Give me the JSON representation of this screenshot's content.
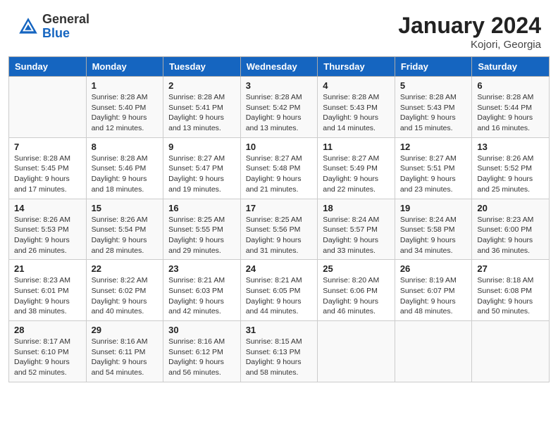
{
  "header": {
    "logo": {
      "general": "General",
      "blue": "Blue"
    },
    "title": "January 2024",
    "location": "Kojori, Georgia"
  },
  "calendar": {
    "columns": [
      "Sunday",
      "Monday",
      "Tuesday",
      "Wednesday",
      "Thursday",
      "Friday",
      "Saturday"
    ],
    "rows": [
      [
        {
          "day": "",
          "sunrise": "",
          "sunset": "",
          "daylight": ""
        },
        {
          "day": "1",
          "sunrise": "Sunrise: 8:28 AM",
          "sunset": "Sunset: 5:40 PM",
          "daylight": "Daylight: 9 hours and 12 minutes."
        },
        {
          "day": "2",
          "sunrise": "Sunrise: 8:28 AM",
          "sunset": "Sunset: 5:41 PM",
          "daylight": "Daylight: 9 hours and 13 minutes."
        },
        {
          "day": "3",
          "sunrise": "Sunrise: 8:28 AM",
          "sunset": "Sunset: 5:42 PM",
          "daylight": "Daylight: 9 hours and 13 minutes."
        },
        {
          "day": "4",
          "sunrise": "Sunrise: 8:28 AM",
          "sunset": "Sunset: 5:43 PM",
          "daylight": "Daylight: 9 hours and 14 minutes."
        },
        {
          "day": "5",
          "sunrise": "Sunrise: 8:28 AM",
          "sunset": "Sunset: 5:43 PM",
          "daylight": "Daylight: 9 hours and 15 minutes."
        },
        {
          "day": "6",
          "sunrise": "Sunrise: 8:28 AM",
          "sunset": "Sunset: 5:44 PM",
          "daylight": "Daylight: 9 hours and 16 minutes."
        }
      ],
      [
        {
          "day": "7",
          "sunrise": "Sunrise: 8:28 AM",
          "sunset": "Sunset: 5:45 PM",
          "daylight": "Daylight: 9 hours and 17 minutes."
        },
        {
          "day": "8",
          "sunrise": "Sunrise: 8:28 AM",
          "sunset": "Sunset: 5:46 PM",
          "daylight": "Daylight: 9 hours and 18 minutes."
        },
        {
          "day": "9",
          "sunrise": "Sunrise: 8:27 AM",
          "sunset": "Sunset: 5:47 PM",
          "daylight": "Daylight: 9 hours and 19 minutes."
        },
        {
          "day": "10",
          "sunrise": "Sunrise: 8:27 AM",
          "sunset": "Sunset: 5:48 PM",
          "daylight": "Daylight: 9 hours and 21 minutes."
        },
        {
          "day": "11",
          "sunrise": "Sunrise: 8:27 AM",
          "sunset": "Sunset: 5:49 PM",
          "daylight": "Daylight: 9 hours and 22 minutes."
        },
        {
          "day": "12",
          "sunrise": "Sunrise: 8:27 AM",
          "sunset": "Sunset: 5:51 PM",
          "daylight": "Daylight: 9 hours and 23 minutes."
        },
        {
          "day": "13",
          "sunrise": "Sunrise: 8:26 AM",
          "sunset": "Sunset: 5:52 PM",
          "daylight": "Daylight: 9 hours and 25 minutes."
        }
      ],
      [
        {
          "day": "14",
          "sunrise": "Sunrise: 8:26 AM",
          "sunset": "Sunset: 5:53 PM",
          "daylight": "Daylight: 9 hours and 26 minutes."
        },
        {
          "day": "15",
          "sunrise": "Sunrise: 8:26 AM",
          "sunset": "Sunset: 5:54 PM",
          "daylight": "Daylight: 9 hours and 28 minutes."
        },
        {
          "day": "16",
          "sunrise": "Sunrise: 8:25 AM",
          "sunset": "Sunset: 5:55 PM",
          "daylight": "Daylight: 9 hours and 29 minutes."
        },
        {
          "day": "17",
          "sunrise": "Sunrise: 8:25 AM",
          "sunset": "Sunset: 5:56 PM",
          "daylight": "Daylight: 9 hours and 31 minutes."
        },
        {
          "day": "18",
          "sunrise": "Sunrise: 8:24 AM",
          "sunset": "Sunset: 5:57 PM",
          "daylight": "Daylight: 9 hours and 33 minutes."
        },
        {
          "day": "19",
          "sunrise": "Sunrise: 8:24 AM",
          "sunset": "Sunset: 5:58 PM",
          "daylight": "Daylight: 9 hours and 34 minutes."
        },
        {
          "day": "20",
          "sunrise": "Sunrise: 8:23 AM",
          "sunset": "Sunset: 6:00 PM",
          "daylight": "Daylight: 9 hours and 36 minutes."
        }
      ],
      [
        {
          "day": "21",
          "sunrise": "Sunrise: 8:23 AM",
          "sunset": "Sunset: 6:01 PM",
          "daylight": "Daylight: 9 hours and 38 minutes."
        },
        {
          "day": "22",
          "sunrise": "Sunrise: 8:22 AM",
          "sunset": "Sunset: 6:02 PM",
          "daylight": "Daylight: 9 hours and 40 minutes."
        },
        {
          "day": "23",
          "sunrise": "Sunrise: 8:21 AM",
          "sunset": "Sunset: 6:03 PM",
          "daylight": "Daylight: 9 hours and 42 minutes."
        },
        {
          "day": "24",
          "sunrise": "Sunrise: 8:21 AM",
          "sunset": "Sunset: 6:05 PM",
          "daylight": "Daylight: 9 hours and 44 minutes."
        },
        {
          "day": "25",
          "sunrise": "Sunrise: 8:20 AM",
          "sunset": "Sunset: 6:06 PM",
          "daylight": "Daylight: 9 hours and 46 minutes."
        },
        {
          "day": "26",
          "sunrise": "Sunrise: 8:19 AM",
          "sunset": "Sunset: 6:07 PM",
          "daylight": "Daylight: 9 hours and 48 minutes."
        },
        {
          "day": "27",
          "sunrise": "Sunrise: 8:18 AM",
          "sunset": "Sunset: 6:08 PM",
          "daylight": "Daylight: 9 hours and 50 minutes."
        }
      ],
      [
        {
          "day": "28",
          "sunrise": "Sunrise: 8:17 AM",
          "sunset": "Sunset: 6:10 PM",
          "daylight": "Daylight: 9 hours and 52 minutes."
        },
        {
          "day": "29",
          "sunrise": "Sunrise: 8:16 AM",
          "sunset": "Sunset: 6:11 PM",
          "daylight": "Daylight: 9 hours and 54 minutes."
        },
        {
          "day": "30",
          "sunrise": "Sunrise: 8:16 AM",
          "sunset": "Sunset: 6:12 PM",
          "daylight": "Daylight: 9 hours and 56 minutes."
        },
        {
          "day": "31",
          "sunrise": "Sunrise: 8:15 AM",
          "sunset": "Sunset: 6:13 PM",
          "daylight": "Daylight: 9 hours and 58 minutes."
        },
        {
          "day": "",
          "sunrise": "",
          "sunset": "",
          "daylight": ""
        },
        {
          "day": "",
          "sunrise": "",
          "sunset": "",
          "daylight": ""
        },
        {
          "day": "",
          "sunrise": "",
          "sunset": "",
          "daylight": ""
        }
      ]
    ]
  }
}
